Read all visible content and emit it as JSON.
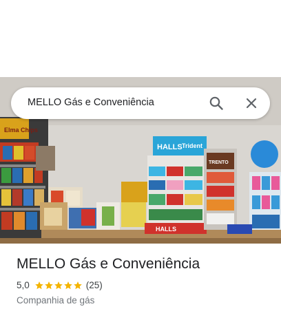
{
  "search": {
    "query": "MELLO Gás e Conveniência"
  },
  "hero": {
    "signs": {
      "halls": "HALLS",
      "trident": "Trident",
      "trento": "TRENTO",
      "elma_chips": "Elma Chips"
    }
  },
  "place": {
    "title": "MELLO Gás e Conveniência",
    "rating": "5,0",
    "stars": 5,
    "review_count": "(25)",
    "category": "Companhia de gás"
  },
  "colors": {
    "star": "#f4b400",
    "text_primary": "#202124",
    "text_secondary": "#70757a"
  }
}
